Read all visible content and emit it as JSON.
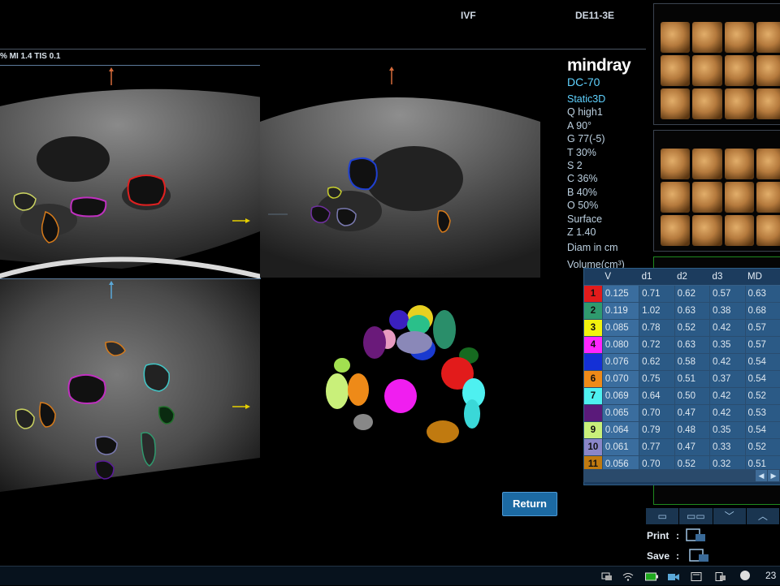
{
  "header": {
    "preset": "IVF",
    "probe": "DE11-3E",
    "mi_tis": "% MI 1.4 TIS 0.1"
  },
  "brand": {
    "name": "mindray",
    "model": "DC-70",
    "mode": "Static3D"
  },
  "parameters": [
    "Q high1",
    "A 90°",
    "G 77(-5)",
    "T 30%",
    "S 2",
    "C 36%",
    "B 40%",
    "O 50%",
    "Surface",
    "Z 1.40"
  ],
  "diam_label": "Diam in cm",
  "volume_label": "Volume(cm³)",
  "table": {
    "columns": [
      "",
      "V",
      "d1",
      "d2",
      "d3",
      "MD"
    ],
    "rows": [
      {
        "n": "1",
        "color": "#e21b1b",
        "v": "0.125",
        "d1": "0.71",
        "d2": "0.62",
        "d3": "0.57",
        "md": "0.63"
      },
      {
        "n": "2",
        "color": "#2f9a6e",
        "v": "0.119",
        "d1": "1.02",
        "d2": "0.63",
        "d3": "0.38",
        "md": "0.68"
      },
      {
        "n": "3",
        "color": "#f2f20d",
        "v": "0.085",
        "d1": "0.78",
        "d2": "0.52",
        "d3": "0.42",
        "md": "0.57"
      },
      {
        "n": "4",
        "color": "#ff25ff",
        "v": "0.080",
        "d1": "0.72",
        "d2": "0.63",
        "d3": "0.35",
        "md": "0.57"
      },
      {
        "n": "",
        "color": "#1430d6",
        "v": "0.076",
        "d1": "0.62",
        "d2": "0.58",
        "d3": "0.42",
        "md": "0.54"
      },
      {
        "n": "6",
        "color": "#ee8a18",
        "v": "0.070",
        "d1": "0.75",
        "d2": "0.51",
        "d3": "0.37",
        "md": "0.54"
      },
      {
        "n": "7",
        "color": "#4ef0f0",
        "v": "0.069",
        "d1": "0.64",
        "d2": "0.50",
        "d3": "0.42",
        "md": "0.52"
      },
      {
        "n": "",
        "color": "#5a1a7a",
        "v": "0.065",
        "d1": "0.70",
        "d2": "0.47",
        "d3": "0.42",
        "md": "0.53"
      },
      {
        "n": "9",
        "color": "#c9f07a",
        "v": "0.064",
        "d1": "0.79",
        "d2": "0.48",
        "d3": "0.35",
        "md": "0.54"
      },
      {
        "n": "10",
        "color": "#8a86c8",
        "v": "0.061",
        "d1": "0.77",
        "d2": "0.47",
        "d3": "0.33",
        "md": "0.52"
      },
      {
        "n": "11",
        "color": "#c07a10",
        "v": "0.056",
        "d1": "0.70",
        "d2": "0.52",
        "d3": "0.32",
        "md": "0.51"
      }
    ]
  },
  "buttons": {
    "return": "Return",
    "print": "Print",
    "save": "Save",
    "colon": ":"
  },
  "taskbar": {
    "clock": "23"
  }
}
